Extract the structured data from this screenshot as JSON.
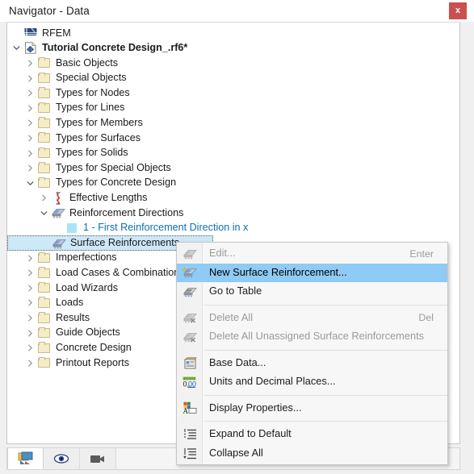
{
  "window": {
    "title": "Navigator - Data",
    "close_label": "x"
  },
  "tree": {
    "root": {
      "label": "RFEM",
      "icon": "rfem-logo-icon"
    },
    "items": [
      {
        "label": "Tutorial Concrete Design_.rf6*",
        "indent": 0,
        "arrow": "down",
        "icon": "model-document-icon",
        "bold": true
      },
      {
        "label": "Basic Objects",
        "indent": 1,
        "arrow": "right",
        "icon": "folder-icon"
      },
      {
        "label": "Special Objects",
        "indent": 1,
        "arrow": "right",
        "icon": "folder-icon"
      },
      {
        "label": "Types for Nodes",
        "indent": 1,
        "arrow": "right",
        "icon": "folder-icon"
      },
      {
        "label": "Types for Lines",
        "indent": 1,
        "arrow": "right",
        "icon": "folder-icon"
      },
      {
        "label": "Types for Members",
        "indent": 1,
        "arrow": "right",
        "icon": "folder-icon"
      },
      {
        "label": "Types for Surfaces",
        "indent": 1,
        "arrow": "right",
        "icon": "folder-icon"
      },
      {
        "label": "Types for Solids",
        "indent": 1,
        "arrow": "right",
        "icon": "folder-icon"
      },
      {
        "label": "Types for Special Objects",
        "indent": 1,
        "arrow": "right",
        "icon": "folder-icon"
      },
      {
        "label": "Types for Concrete Design",
        "indent": 1,
        "arrow": "down",
        "icon": "folder-open-icon"
      },
      {
        "label": "Effective Lengths",
        "indent": 2,
        "arrow": "right",
        "icon": "effective-lengths-icon"
      },
      {
        "label": "Reinforcement Directions",
        "indent": 2,
        "arrow": "down",
        "icon": "reinforcement-directions-icon"
      },
      {
        "label": "1 - First Reinforcement Direction in x",
        "indent": 3,
        "arrow": "none",
        "icon": "color-swatch-icon",
        "color": "#0a6fb5"
      },
      {
        "label": "Surface Reinforcements",
        "indent": 2,
        "arrow": "none",
        "icon": "surface-reinforcements-icon",
        "selected": true
      },
      {
        "label": "Imperfections",
        "indent": 1,
        "arrow": "right",
        "icon": "folder-icon"
      },
      {
        "label": "Load Cases & Combinations",
        "indent": 1,
        "arrow": "right",
        "icon": "folder-icon"
      },
      {
        "label": "Load Wizards",
        "indent": 1,
        "arrow": "right",
        "icon": "folder-icon"
      },
      {
        "label": "Loads",
        "indent": 1,
        "arrow": "right",
        "icon": "folder-icon"
      },
      {
        "label": "Results",
        "indent": 1,
        "arrow": "right",
        "icon": "folder-icon"
      },
      {
        "label": "Guide Objects",
        "indent": 1,
        "arrow": "right",
        "icon": "folder-icon"
      },
      {
        "label": "Concrete Design",
        "indent": 1,
        "arrow": "right",
        "icon": "folder-icon"
      },
      {
        "label": "Printout Reports",
        "indent": 1,
        "arrow": "right",
        "icon": "folder-icon"
      }
    ]
  },
  "context_menu": {
    "items": [
      {
        "label": "Edit...",
        "shortcut": "Enter",
        "icon": "edit-surface-reinforcement-icon",
        "state": "disabled"
      },
      {
        "label": "New Surface Reinforcement...",
        "shortcut": "",
        "icon": "new-surface-reinforcement-icon",
        "state": "highlighted"
      },
      {
        "label": "Go to Table",
        "shortcut": "",
        "icon": "go-to-table-icon",
        "state": "normal"
      },
      {
        "separator": true
      },
      {
        "label": "Delete All",
        "shortcut": "Del",
        "icon": "delete-all-icon",
        "state": "disabled"
      },
      {
        "label": "Delete All Unassigned Surface Reinforcements",
        "shortcut": "",
        "icon": "delete-unassigned-icon",
        "state": "disabled"
      },
      {
        "separator": true
      },
      {
        "label": "Base Data...",
        "shortcut": "",
        "icon": "base-data-icon",
        "state": "normal"
      },
      {
        "label": "Units and Decimal Places...",
        "shortcut": "",
        "icon": "units-decimal-places-icon",
        "state": "normal"
      },
      {
        "separator": true
      },
      {
        "label": "Display Properties...",
        "shortcut": "",
        "icon": "display-properties-icon",
        "state": "normal"
      },
      {
        "separator": true
      },
      {
        "label": "Expand to Default",
        "shortcut": "",
        "icon": "expand-to-default-icon",
        "state": "normal"
      },
      {
        "label": "Collapse All",
        "shortcut": "",
        "icon": "collapse-all-icon",
        "state": "normal"
      }
    ]
  },
  "bottom_toolbar": {
    "buttons": [
      {
        "icon": "navigator-data-tab-icon",
        "active": true
      },
      {
        "icon": "display-eye-tab-icon",
        "active": false
      },
      {
        "icon": "video-camera-tab-icon",
        "active": false
      }
    ]
  },
  "colors": {
    "highlight": "#8fcbf5",
    "selection": "#cde8f7",
    "link": "#0a6fb5",
    "close": "#c9504f"
  }
}
